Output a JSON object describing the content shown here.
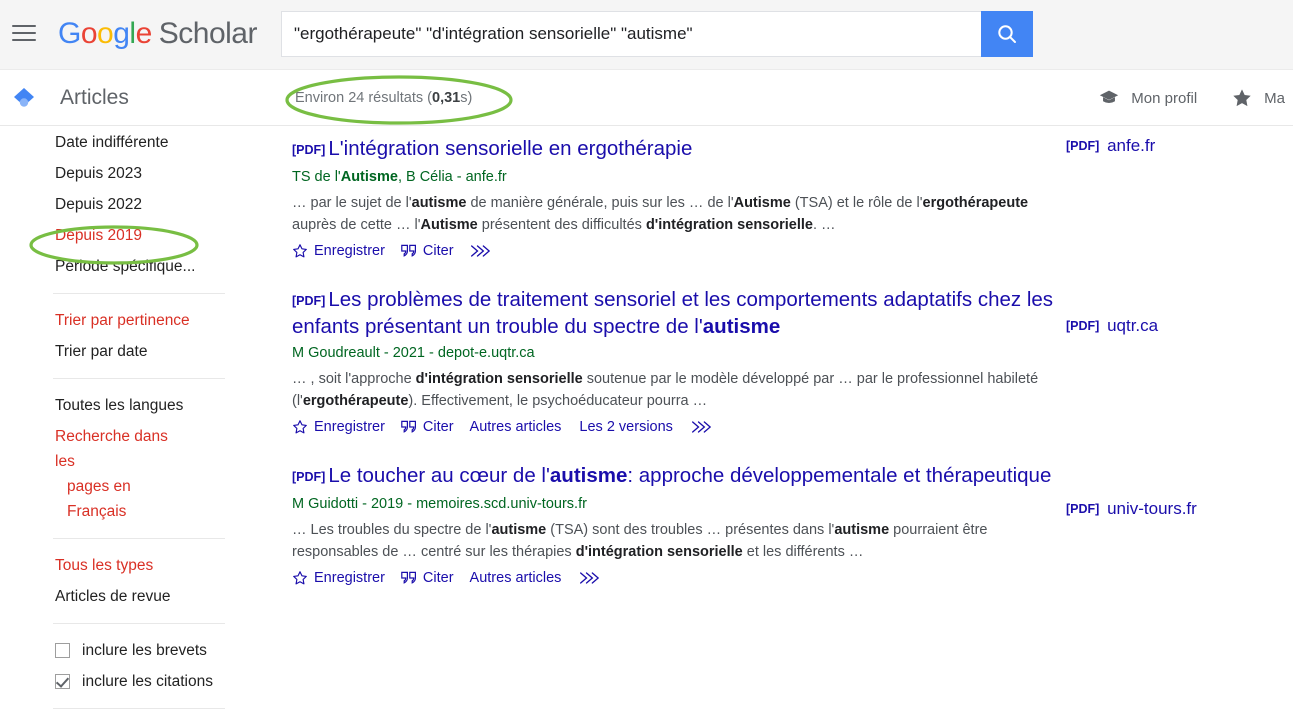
{
  "header": {
    "menu_icon": "hamburger-menu-icon",
    "brand": {
      "g": "G",
      "o1": "o",
      "o2": "o",
      "g2": "g",
      "l": "l",
      "e": "e",
      "scholar": "Scholar"
    },
    "search": {
      "value": "\"ergothérapeute\" \"d'intégration sensorielle\" \"autisme\"",
      "placeholder": "",
      "button_icon": "search-icon"
    }
  },
  "subheader": {
    "section_icon": "articles-diamond-icon",
    "section_label": "Articles",
    "results_prefix": "Environ 24 résultats (",
    "results_time": "0,31",
    "results_suffix": " s)",
    "links": [
      {
        "label": "Mon profil",
        "icon": "graduation-cap-icon"
      },
      {
        "label": "Ma",
        "icon": "star-icon"
      }
    ]
  },
  "sidebar": {
    "dates": [
      {
        "label": "Date indifférente",
        "active": false
      },
      {
        "label": "Depuis 2023",
        "active": false
      },
      {
        "label": "Depuis 2022",
        "active": false
      },
      {
        "label": "Depuis 2019",
        "active": true
      },
      {
        "label": "Période spécifique...",
        "active": false
      }
    ],
    "sort": [
      {
        "label": "Trier par pertinence",
        "active": true
      },
      {
        "label": "Trier par date",
        "active": false
      }
    ],
    "languages": [
      {
        "label": "Toutes les langues",
        "active": false
      },
      {
        "label": "Recherche dans les",
        "label2": "pages en Français",
        "active": true
      }
    ],
    "types": [
      {
        "label": "Tous les types",
        "active": true
      },
      {
        "label": "Articles de revue",
        "active": false
      }
    ],
    "checkboxes": [
      {
        "label": "inclure les brevets",
        "checked": false
      },
      {
        "label": "inclure les citations",
        "checked": true
      }
    ]
  },
  "results": [
    {
      "pdf_tag": "[PDF]",
      "title_parts": [
        {
          "t": "L'intégration sensorielle en ergothérapie",
          "b": false
        }
      ],
      "meta_parts": [
        {
          "t": "TS de l'",
          "b": false
        },
        {
          "t": "Autisme",
          "b": true
        },
        {
          "t": ", B Célia - anfe.fr",
          "b": false
        }
      ],
      "snippet_parts": [
        {
          "t": "… par le sujet de l'",
          "b": false
        },
        {
          "t": "autisme",
          "b": true
        },
        {
          "t": " de manière générale, puis sur les … de l'",
          "b": false
        },
        {
          "t": "Autisme",
          "b": true
        },
        {
          "t": " (TSA) et le rôle de l'",
          "b": false
        },
        {
          "t": "ergothérapeute",
          "b": true
        },
        {
          "t": " auprès de cette … l'",
          "b": false
        },
        {
          "t": "Autisme",
          "b": true
        },
        {
          "t": " présentent des difficultés ",
          "b": false
        },
        {
          "t": "d'intégration sensorielle",
          "b": true
        },
        {
          "t": ". …",
          "b": false
        }
      ],
      "actions": [
        {
          "label": "Enregistrer",
          "icon": "star-outline-icon"
        },
        {
          "label": "Citer",
          "icon": "quote-icon"
        },
        {
          "label": "",
          "icon": "more-chevrons-icon"
        }
      ],
      "pdf_link": {
        "tag": "[PDF]",
        "domain": "anfe.fr"
      }
    },
    {
      "pdf_tag": "[PDF]",
      "title_parts": [
        {
          "t": "Les problèmes de traitement sensoriel et les comportements adaptatifs chez les enfants présentant un trouble du spectre de l'",
          "b": false
        },
        {
          "t": "autisme",
          "b": true
        }
      ],
      "meta_parts": [
        {
          "t": "M Goudreault - 2021 - depot-e.uqtr.ca",
          "b": false
        }
      ],
      "snippet_parts": [
        {
          "t": "… , soit l'approche ",
          "b": false
        },
        {
          "t": "d'intégration sensorielle",
          "b": true
        },
        {
          "t": " soutenue par le modèle développé par … par le professionnel habileté (l'",
          "b": false
        },
        {
          "t": "ergothérapeute",
          "b": true
        },
        {
          "t": "). Effectivement, le psychoéducateur pourra …",
          "b": false
        }
      ],
      "actions": [
        {
          "label": "Enregistrer",
          "icon": "star-outline-icon"
        },
        {
          "label": "Citer",
          "icon": "quote-icon"
        },
        {
          "label": "Autres articles",
          "icon": ""
        },
        {
          "label": "Les 2 versions",
          "icon": ""
        },
        {
          "label": "",
          "icon": "more-chevrons-icon"
        }
      ],
      "pdf_link": {
        "tag": "[PDF]",
        "domain": "uqtr.ca"
      }
    },
    {
      "pdf_tag": "[PDF]",
      "title_parts": [
        {
          "t": "Le toucher au cœur de l'",
          "b": false
        },
        {
          "t": "autisme",
          "b": true
        },
        {
          "t": ": approche développementale et thérapeutique",
          "b": false
        }
      ],
      "meta_parts": [
        {
          "t": "M Guidotti - 2019 - memoires.scd.univ-tours.fr",
          "b": false
        }
      ],
      "snippet_parts": [
        {
          "t": "… Les troubles du spectre de l'",
          "b": false
        },
        {
          "t": "autisme",
          "b": true
        },
        {
          "t": " (TSA) sont des troubles … présentes dans l'",
          "b": false
        },
        {
          "t": "autisme",
          "b": true
        },
        {
          "t": " pourraient être responsables de … centré sur les thérapies ",
          "b": false
        },
        {
          "t": "d'intégration sensorielle",
          "b": true
        },
        {
          "t": " et les différents …",
          "b": false
        }
      ],
      "actions": [
        {
          "label": "Enregistrer",
          "icon": "star-outline-icon"
        },
        {
          "label": "Citer",
          "icon": "quote-icon"
        },
        {
          "label": "Autres articles",
          "icon": ""
        },
        {
          "label": "",
          "icon": "more-chevrons-icon"
        }
      ],
      "pdf_link": {
        "tag": "[PDF]",
        "domain": "univ-tours.fr"
      }
    }
  ],
  "annotations": {
    "color": "#78be43",
    "items": [
      {
        "name": "results-count-highlight"
      },
      {
        "name": "depuis-2019-highlight"
      }
    ]
  }
}
